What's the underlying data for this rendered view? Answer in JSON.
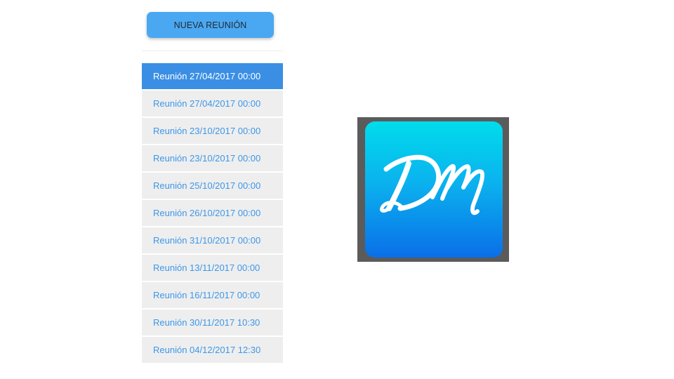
{
  "toolbar": {
    "new_meeting_label": "NUEVA REUNIÓN"
  },
  "meetings": [
    {
      "label": "Reunión 27/04/2017 00:00",
      "selected": true
    },
    {
      "label": "Reunión 27/04/2017 00:00",
      "selected": false
    },
    {
      "label": "Reunión 23/10/2017 00:00",
      "selected": false
    },
    {
      "label": "Reunión 23/10/2017 00:00",
      "selected": false
    },
    {
      "label": "Reunión 25/10/2017 00:00",
      "selected": false
    },
    {
      "label": "Reunión 26/10/2017 00:00",
      "selected": false
    },
    {
      "label": "Reunión 31/10/2017 00:00",
      "selected": false
    },
    {
      "label": "Reunión 13/11/2017 00:00",
      "selected": false
    },
    {
      "label": "Reunión 16/11/2017 00:00",
      "selected": false
    },
    {
      "label": "Reunión 30/11/2017 10:30",
      "selected": false
    },
    {
      "label": "Reunión 04/12/2017 12:30",
      "selected": false
    }
  ],
  "logo": {
    "text": "DM",
    "icon": "dm-monogram-logo",
    "colors": {
      "gradient_top": "#00dcec",
      "gradient_bottom": "#0a6fe8",
      "frame": "#5b5b5b"
    }
  },
  "colors": {
    "button_bg": "#4aa8f2",
    "selected_bg": "#3a8fe4",
    "item_bg": "#eeeeee",
    "item_text": "#3d97e8"
  }
}
